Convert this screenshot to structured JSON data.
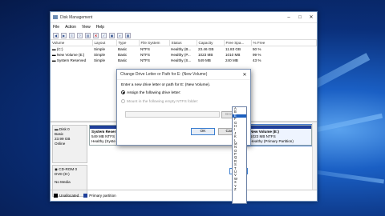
{
  "window": {
    "title": "Disk Management",
    "controls": [
      "–",
      "□",
      "✕"
    ]
  },
  "menu": [
    "File",
    "Action",
    "View",
    "Help"
  ],
  "toolbar_icons": [
    "back-icon",
    "forward-icon",
    "list-icon",
    "help-icon",
    "properties-icon",
    "delete-icon",
    "checklist-icon",
    "open-icon",
    "search-icon",
    "grid-icon"
  ],
  "table": {
    "headers": [
      "Volume",
      "Layout",
      "Type",
      "File System",
      "Status",
      "Capacity",
      "Free Spa...",
      "% Free"
    ],
    "rows": [
      [
        "(C:)",
        "Simple",
        "Basic",
        "NTFS",
        "Healthy (B...",
        "23.46 GB",
        "11.83 GB",
        "50 %"
      ],
      [
        "New Volume (E:)",
        "Simple",
        "Basic",
        "NTFS",
        "Healthy (P...",
        "1023 MB",
        "1010 MB",
        "99 %"
      ],
      [
        "System Reserved",
        "Simple",
        "Basic",
        "NTFS",
        "Healthy (S...",
        "549 MB",
        "240 MB",
        "43 %"
      ]
    ]
  },
  "disk0": {
    "name": "Disk 0",
    "type": "Basic",
    "size": "23.99 GB",
    "state": "Online"
  },
  "system_reserved": {
    "name": "System Reser",
    "line2": "549 MB NTFS",
    "line3": "Healthy (Syste"
  },
  "new_volume": {
    "name": "New Volume (E:)",
    "line2": "1023 MB NTFS",
    "line3": "Healthy (Primary Partition)"
  },
  "cdrom": {
    "name": "CD-ROM 0",
    "type": "DVD (D:)",
    "media": "No Media"
  },
  "legend": [
    {
      "label": "Unallocated",
      "color": "#000000"
    },
    {
      "label": "Primary partition",
      "color": "#1f3f9a"
    }
  ],
  "dialog": {
    "title": "Change Drive Letter or Path for E: (New Volume)",
    "close": "✕",
    "prompt": "Enter a new drive letter or path for E: (New Volume).",
    "option_assign": "Assign the following drive letter:",
    "option_mount": "Mount in the following empty NTFS folder:",
    "ok": "OK",
    "cancel": "Cancel",
    "browse": "Browse..."
  },
  "combo_value": "E",
  "dropdown_letters": [
    "A",
    "B",
    "E",
    "F",
    "G",
    "H",
    "I",
    "J",
    "K",
    "L",
    "M",
    "N",
    "O",
    "P",
    "Q",
    "R",
    "S",
    "T",
    "U",
    "V",
    "W",
    "X",
    "Y",
    "Z",
    "",
    "",
    ""
  ],
  "dropdown_selected_index": 2,
  "colors": {
    "accent": "#1c5fbf",
    "partition": "#1f3f9a",
    "desktop": "#0a2f7a"
  }
}
